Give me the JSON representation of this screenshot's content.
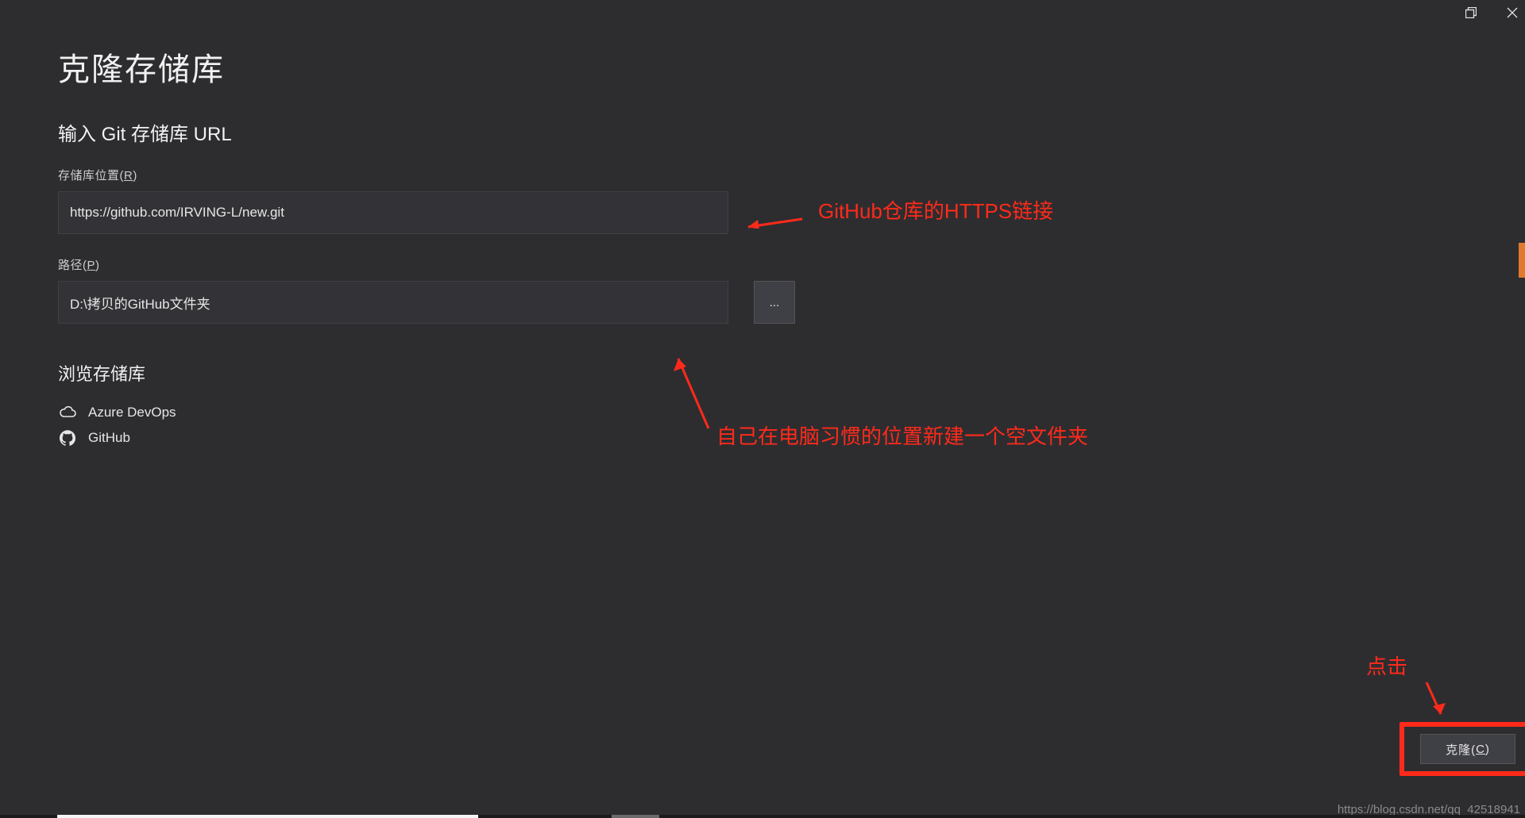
{
  "window": {
    "restore_title": "Restore",
    "close_title": "Close"
  },
  "title": "克隆存储库",
  "subtitle": "输入 Git 存储库 URL",
  "repo_location": {
    "label_pre": "存储库位置(",
    "label_hot": "R",
    "label_post": ")",
    "value": "https://github.com/IRVING-L/new.git"
  },
  "path": {
    "label_pre": "路径(",
    "label_hot": "P",
    "label_post": ")",
    "value": "D:\\拷贝的GitHub文件夹",
    "browse_label": "..."
  },
  "browse_section": {
    "title": "浏览存储库",
    "items": [
      {
        "key": "azure",
        "label": "Azure DevOps"
      },
      {
        "key": "github",
        "label": "GitHub"
      }
    ]
  },
  "clone": {
    "label_pre": "克隆(",
    "label_hot": "C",
    "label_post": ")"
  },
  "annotations": {
    "a1": "GitHub仓库的HTTPS链接",
    "a2": "自己在电脑习惯的位置新建一个空文件夹",
    "a3": "点击"
  },
  "watermark": "https://blog.csdn.net/qq_42518941"
}
